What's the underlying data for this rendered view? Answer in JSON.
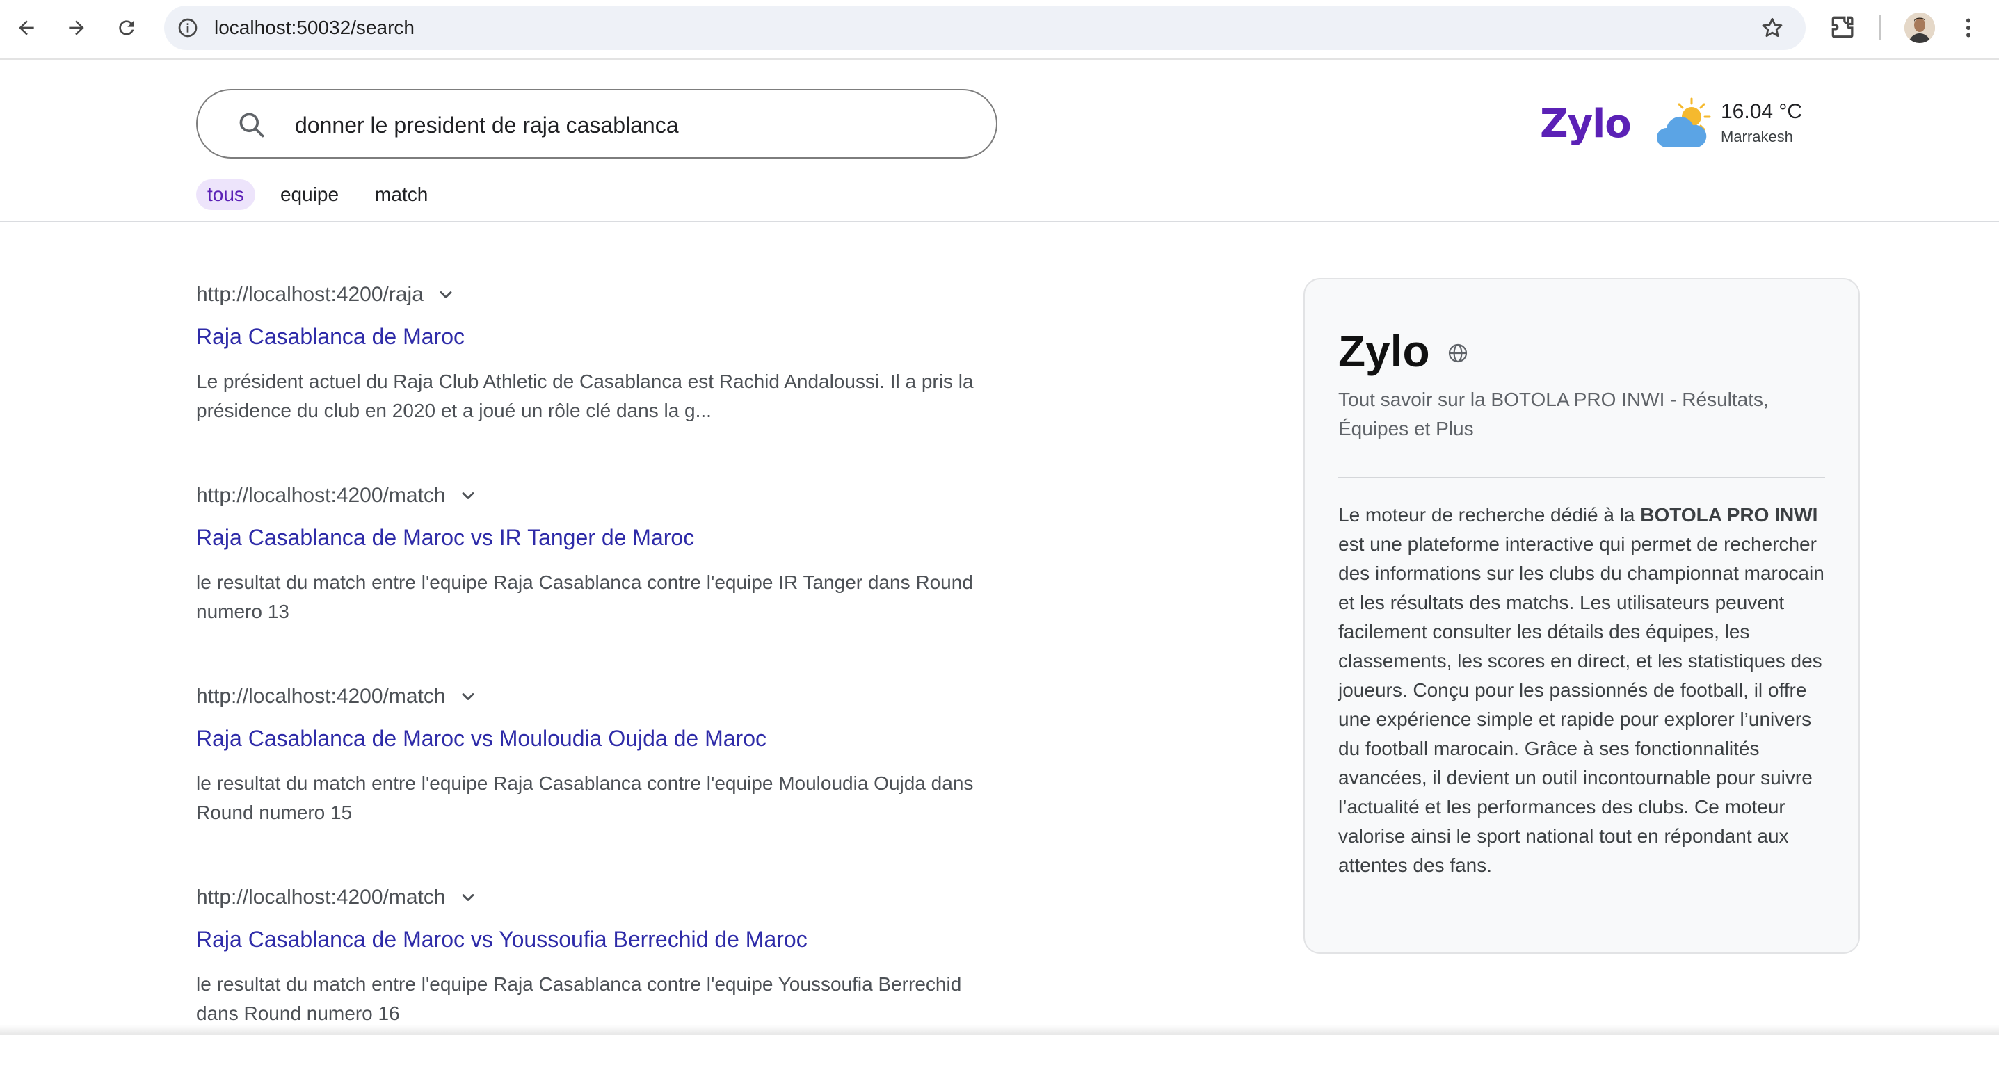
{
  "browser": {
    "url": "localhost:50032/search"
  },
  "header": {
    "search_query": "donner le president de raja casablanca",
    "logo": "Zylo",
    "weather": {
      "temperature": "16.04 °C",
      "city": "Marrakesh"
    },
    "tabs": [
      {
        "label": "tous",
        "active": true
      },
      {
        "label": "equipe",
        "active": false
      },
      {
        "label": "match",
        "active": false
      }
    ]
  },
  "results": [
    {
      "url": "http://localhost:4200/raja",
      "title": "Raja Casablanca de Maroc",
      "snippet": "Le président actuel du Raja Club Athletic de Casablanca est Rachid Andaloussi. Il a pris la présidence du club en 2020 et a joué un rôle clé dans la g..."
    },
    {
      "url": "http://localhost:4200/match",
      "title": "Raja Casablanca de Maroc vs IR Tanger de Maroc",
      "snippet": "le resultat du match entre l'equipe Raja Casablanca contre l'equipe IR Tanger dans Round numero 13"
    },
    {
      "url": "http://localhost:4200/match",
      "title": "Raja Casablanca de Maroc vs Mouloudia Oujda de Maroc",
      "snippet": "le resultat du match entre l'equipe Raja Casablanca contre l'equipe Mouloudia Oujda dans Round numero 15"
    },
    {
      "url": "http://localhost:4200/match",
      "title": "Raja Casablanca de Maroc vs Youssoufia Berrechid de Maroc",
      "snippet": "le resultat du match entre l'equipe Raja Casablanca contre l'equipe Youssoufia Berrechid dans Round numero 16"
    }
  ],
  "knowledge_panel": {
    "title": "Zylo",
    "subtitle": "Tout savoir sur la BOTOLA PRO INWI - Résultats, Équipes et Plus",
    "desc_intro": "Le moteur de recherche dédié à la ",
    "desc_bold": "BOTOLA PRO INWI",
    "desc_rest": " est une plateforme interactive qui permet de rechercher des informations sur les clubs du championnat marocain et les résultats des matchs. Les utilisateurs peuvent facilement consulter les détails des équipes, les classements, les scores en direct, et les statistiques des joueurs. Conçu pour les passionnés de football, il offre une expérience simple et rapide pour explorer l’univers du football marocain. Grâce à ses fonctionnalités avancées, il devient un outil incontournable pour suivre l’actualité et les performances des clubs. Ce moteur valorise ainsi le sport national tout en répondant aux attentes des fans."
  }
}
